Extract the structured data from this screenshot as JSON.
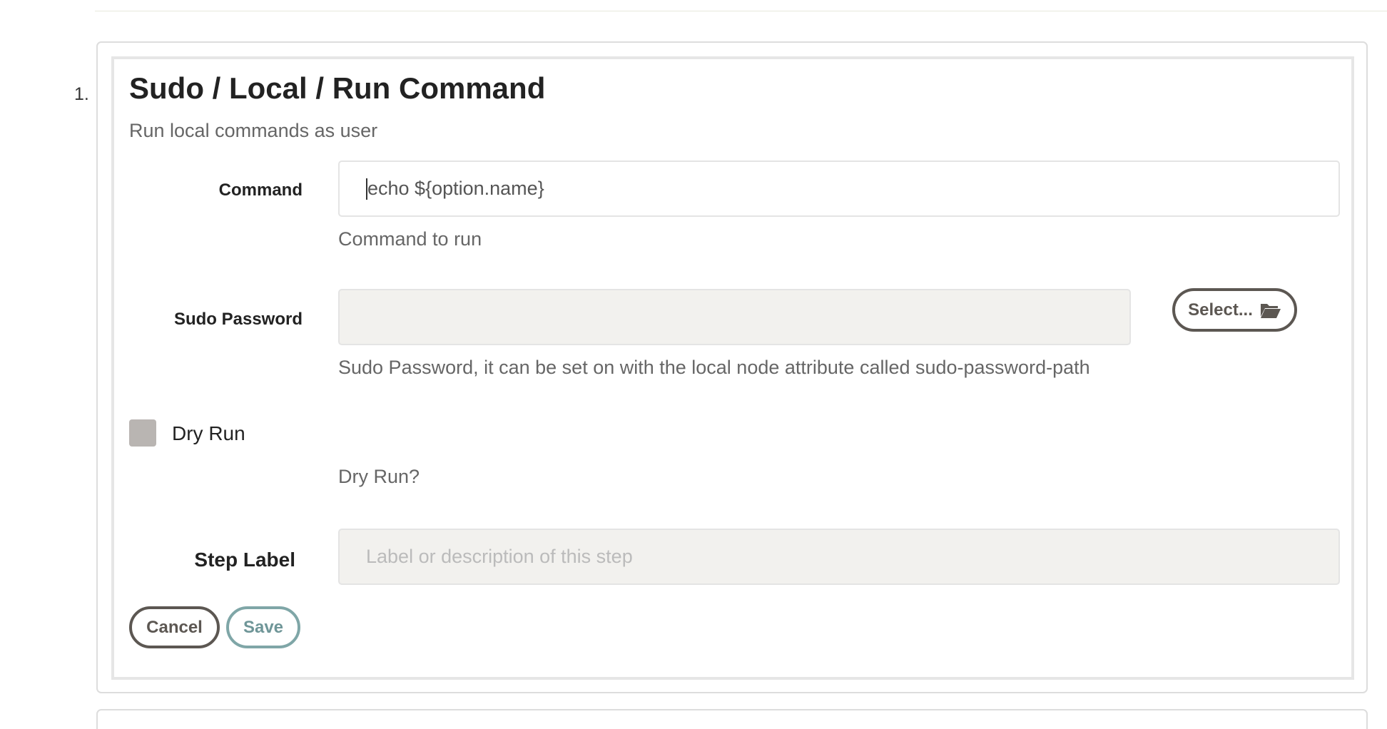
{
  "step": {
    "number": "1.",
    "title": "Sudo / Local / Run Command",
    "subtitle": "Run local commands as user"
  },
  "command": {
    "label": "Command",
    "value": "echo ${option.name}",
    "help": "Command to run"
  },
  "sudo_password": {
    "label": "Sudo Password",
    "value": "",
    "help": "Sudo Password, it can be set on with the local node attribute called sudo-password-path",
    "select_label": "Select...",
    "select_icon": "folder-open-icon"
  },
  "dry_run": {
    "label": "Dry Run",
    "checked": false,
    "help": "Dry Run?"
  },
  "step_label": {
    "label": "Step Label",
    "placeholder": "Label or description of this step",
    "value": ""
  },
  "actions": {
    "cancel_label": "Cancel",
    "save_label": "Save"
  },
  "colors": {
    "dark_button": "#5c5752",
    "save_button": "#7fa6a7",
    "checkbox": "#b9b5b2",
    "input_readonly_bg": "#f2f1ee"
  }
}
